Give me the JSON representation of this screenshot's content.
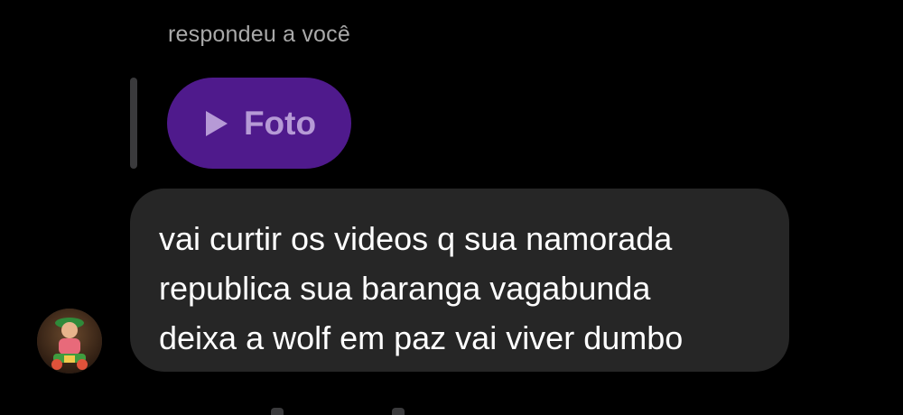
{
  "reply": {
    "caption": "respondeu a você",
    "quoted_media_label": "Foto",
    "quoted_media_icon": "play-icon"
  },
  "message": {
    "text": "vai curtir os videos q sua namorada\nrepublica sua baranga vagabunda\ndeixa a wolf em paz vai viver dumbo"
  },
  "colors": {
    "background": "#000000",
    "bubble": "#262626",
    "photo_chip": "#4f1a8c",
    "photo_chip_text": "#b69ad6",
    "caption": "#a9a9a9"
  }
}
